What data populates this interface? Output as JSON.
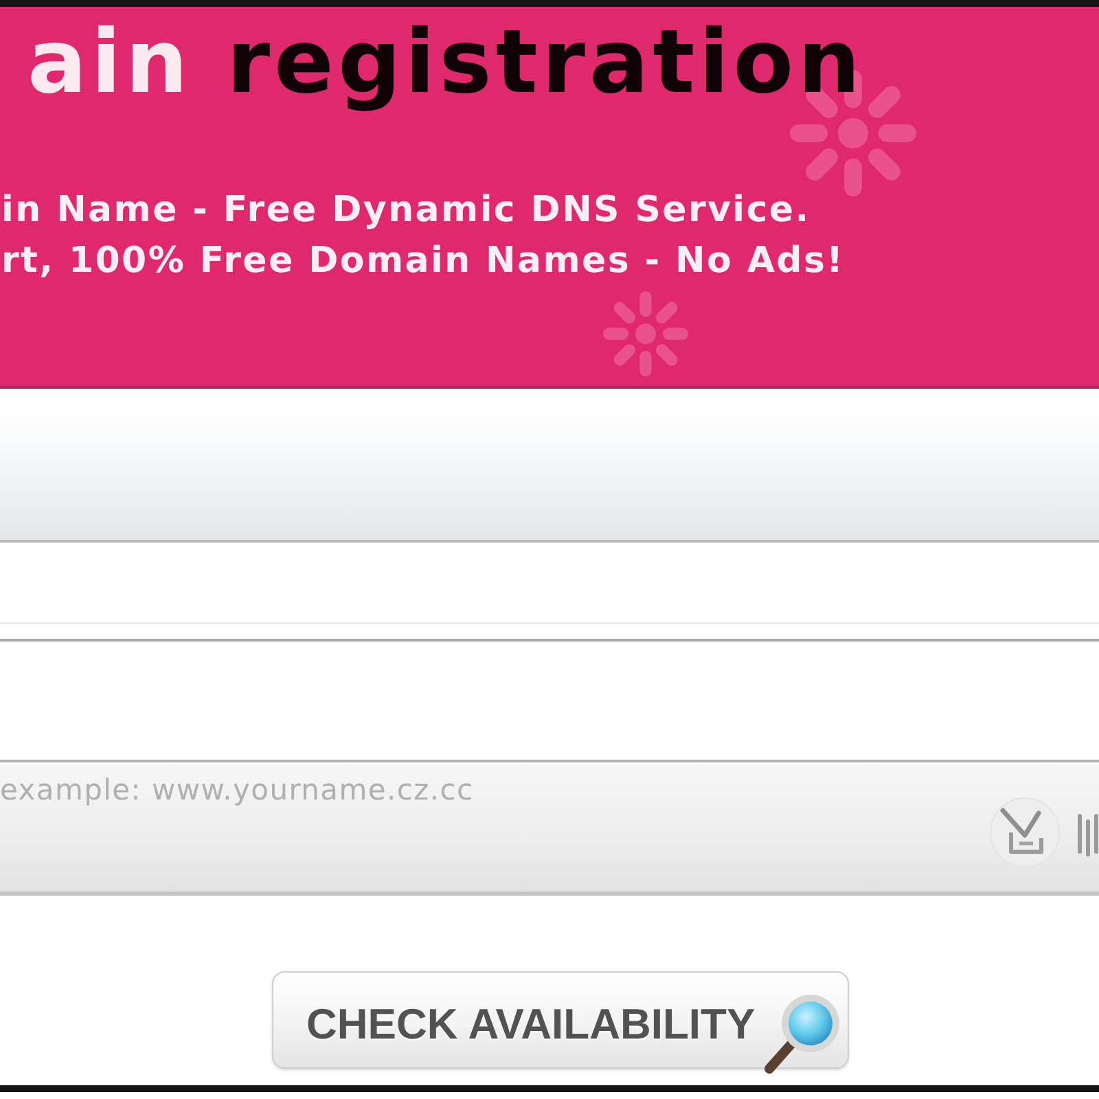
{
  "banner": {
    "title_parts": [
      {
        "text": "ain",
        "kind": "highlight"
      },
      {
        "text": "registration",
        "kind": "plain"
      }
    ],
    "lines": [
      "in Name - Free Dynamic DNS Service.",
      "rt, 100% Free Domain Names - No Ads!"
    ]
  },
  "domain_field": {
    "placeholder": "example: www.yourname.cz.cc"
  },
  "check_button": {
    "label": "CHECK AVAILABILITY"
  }
}
